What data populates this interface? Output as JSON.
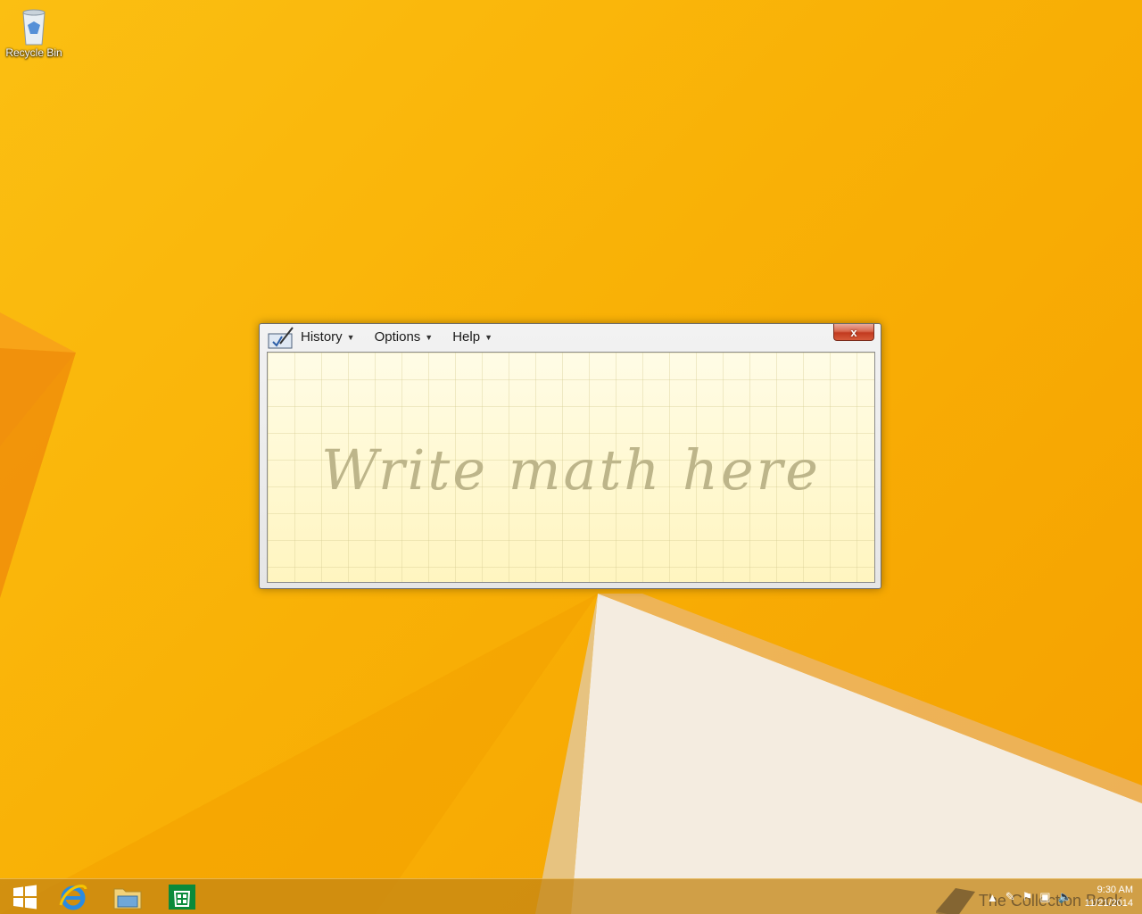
{
  "desktop": {
    "icons": [
      {
        "label": "Recycle Bin",
        "icon": "recycle-bin-icon"
      }
    ]
  },
  "math_window": {
    "menus": [
      {
        "label": "History"
      },
      {
        "label": "Options"
      },
      {
        "label": "Help"
      }
    ],
    "close_label": "x",
    "hint_text": "Write math here"
  },
  "taskbar": {
    "pinned": [
      {
        "name": "start-button",
        "icon": "windows-logo-icon"
      },
      {
        "name": "internet-explorer",
        "icon": "internet-explorer-icon"
      },
      {
        "name": "file-explorer",
        "icon": "folder-icon"
      },
      {
        "name": "store",
        "icon": "store-icon"
      }
    ],
    "watermark": "The Collection Book",
    "clock_time": "9:30 AM",
    "clock_date": "11/21/2014"
  }
}
